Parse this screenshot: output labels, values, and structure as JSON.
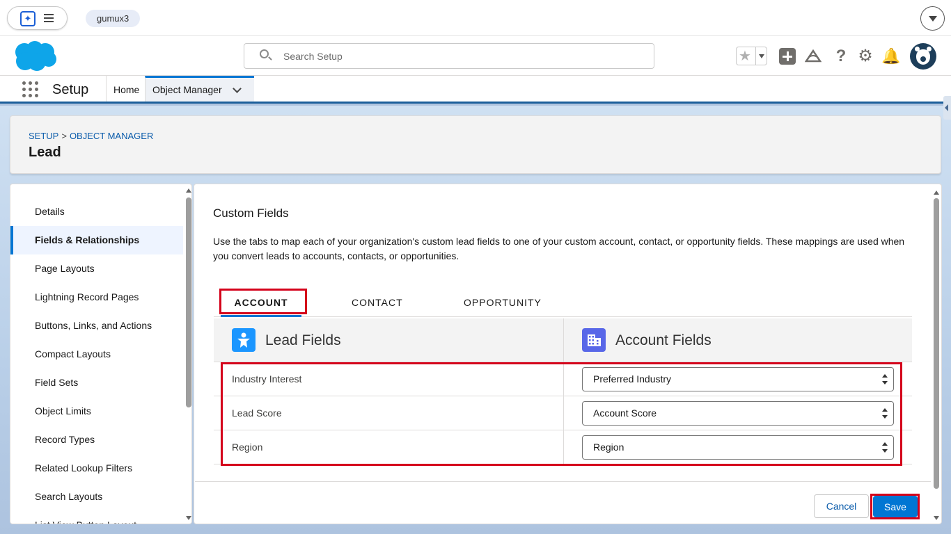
{
  "topbar": {
    "org": "gumux3"
  },
  "header": {
    "search_placeholder": "Search Setup"
  },
  "context": {
    "app_name": "Setup",
    "nav_home": "Home",
    "nav_object_manager": "Object Manager"
  },
  "page": {
    "breadcrumb": [
      "SETUP",
      "OBJECT MANAGER"
    ],
    "breadcrumb_sep": ">",
    "title": "Lead"
  },
  "sidebar": {
    "items": [
      {
        "label": "Details"
      },
      {
        "label": "Fields & Relationships"
      },
      {
        "label": "Page Layouts"
      },
      {
        "label": "Lightning Record Pages"
      },
      {
        "label": "Buttons, Links, and Actions"
      },
      {
        "label": "Compact Layouts"
      },
      {
        "label": "Field Sets"
      },
      {
        "label": "Object Limits"
      },
      {
        "label": "Record Types"
      },
      {
        "label": "Related Lookup Filters"
      },
      {
        "label": "Search Layouts"
      },
      {
        "label": "List View Button Layout"
      }
    ],
    "active_index": 1
  },
  "main": {
    "title": "Custom Fields",
    "description": "Use the tabs to map each of your organization's custom lead fields to one of your custom account, contact, or opportunity fields. These mappings are used when you convert leads to accounts, contacts, or opportunities.",
    "tabs": [
      {
        "label": "ACCOUNT"
      },
      {
        "label": "CONTACT"
      },
      {
        "label": "OPPORTUNITY"
      }
    ],
    "active_tab": 0,
    "columns": {
      "lead": "Lead Fields",
      "account": "Account Fields"
    },
    "rows": [
      {
        "lead_field": "Industry Interest",
        "account_field": "Preferred Industry"
      },
      {
        "lead_field": "Lead Score",
        "account_field": "Account Score"
      },
      {
        "lead_field": "Region",
        "account_field": "Region"
      }
    ]
  },
  "footer": {
    "cancel_label": "Cancel",
    "save_label": "Save"
  },
  "colors": {
    "brand": "#0176d3",
    "highlight": "#d4001a",
    "lead_icon": "#1b96ff",
    "account_icon": "#5867e8"
  },
  "icons": [
    "search-icon",
    "star-icon",
    "add-icon",
    "trailhead-icon",
    "help-icon",
    "gear-icon",
    "bell-icon",
    "avatar",
    "app-launcher-icon",
    "lead-icon",
    "account-icon"
  ]
}
